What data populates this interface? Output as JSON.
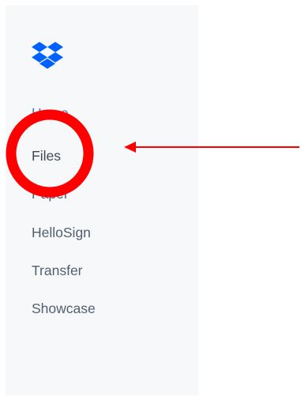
{
  "brand": {
    "logo_icon": "dropbox-logo-icon",
    "color": "#0061fe"
  },
  "sidebar": {
    "items": [
      {
        "label": "Home"
      },
      {
        "label": "Files"
      },
      {
        "label": "Paper"
      },
      {
        "label": "HelloSign"
      },
      {
        "label": "Transfer"
      },
      {
        "label": "Showcase"
      }
    ]
  },
  "annotation": {
    "highlight_color": "#ff0000",
    "target": "Files"
  }
}
